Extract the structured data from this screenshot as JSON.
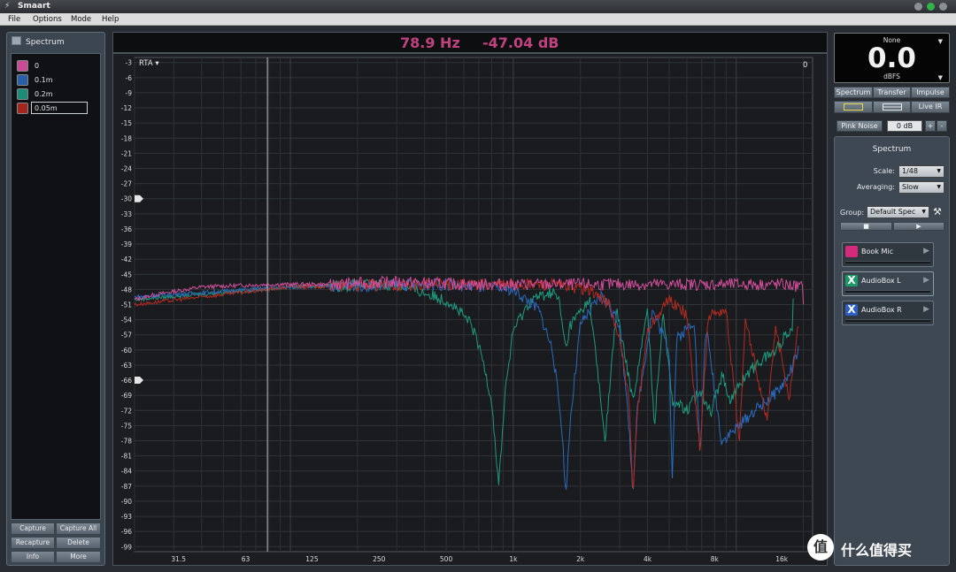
{
  "window": {
    "title": "Smaart"
  },
  "menu": [
    "File",
    "Options",
    "Mode",
    "Help"
  ],
  "left_panel": {
    "header": "Spectrum",
    "traces": [
      {
        "label": "0",
        "color": "#c94b94"
      },
      {
        "label": "0.1m",
        "color": "#2a5fa8"
      },
      {
        "label": "0.2m",
        "color": "#1e8b76"
      },
      {
        "label": "0.05m",
        "color": "#a3261e",
        "editing": true
      }
    ],
    "buttons": [
      "Capture",
      "Capture All",
      "Recapture",
      "Delete",
      "Info",
      "More"
    ]
  },
  "readout": {
    "frequency": "78.9 Hz",
    "level": "-47.04 dB"
  },
  "plot": {
    "mode_label": "RTA ▾",
    "offset_label": "0",
    "y_ticks": [
      "-3",
      "-6",
      "-9",
      "-12",
      "-15",
      "-18",
      "-21",
      "-24",
      "-27",
      "-30",
      "-33",
      "-36",
      "-39",
      "-42",
      "-45",
      "-48",
      "-51",
      "-54",
      "-57",
      "-60",
      "-63",
      "-66",
      "-69",
      "-72",
      "-75",
      "-78",
      "-81",
      "-84",
      "-87",
      "-90",
      "-93",
      "-96",
      "-99"
    ],
    "x_ticks": [
      "31.5",
      "63",
      "125",
      "250",
      "500",
      "1k",
      "2k",
      "4k",
      "8k",
      "16k"
    ]
  },
  "chart_data": {
    "type": "line",
    "title": "",
    "xlabel": "",
    "ylabel": "",
    "x_scale": "log",
    "xlim": [
      20,
      22000
    ],
    "ylim": [
      -100,
      -2
    ],
    "cursor_hz": 78.9,
    "grid": true,
    "series": [
      {
        "name": "0",
        "color": "#d14f9b",
        "points": [
          [
            20,
            -50
          ],
          [
            25,
            -49
          ],
          [
            40,
            -47.5
          ],
          [
            80,
            -47
          ],
          [
            150,
            -47
          ],
          [
            300,
            -46.5
          ],
          [
            600,
            -47
          ],
          [
            1000,
            -47
          ],
          [
            2000,
            -47
          ],
          [
            4000,
            -47
          ],
          [
            8000,
            -47
          ],
          [
            16000,
            -47
          ],
          [
            20000,
            -47.5
          ]
        ]
      },
      {
        "name": "0.1m",
        "color": "#2a6bbf",
        "points": [
          [
            20,
            -49.5
          ],
          [
            100,
            -47.5
          ],
          [
            500,
            -47
          ],
          [
            1000,
            -48
          ],
          [
            1300,
            -52
          ],
          [
            1500,
            -60
          ],
          [
            1650,
            -75
          ],
          [
            1720,
            -89
          ],
          [
            1800,
            -74
          ],
          [
            2000,
            -55
          ],
          [
            2500,
            -49
          ],
          [
            3000,
            -55
          ],
          [
            3300,
            -75
          ],
          [
            3440,
            -88
          ],
          [
            3600,
            -72
          ],
          [
            4200,
            -52
          ],
          [
            5000,
            -60
          ],
          [
            5160,
            -85
          ],
          [
            5400,
            -58
          ],
          [
            6500,
            -54
          ],
          [
            6880,
            -82
          ],
          [
            7300,
            -55
          ],
          [
            8600,
            -78
          ],
          [
            10320,
            -75
          ],
          [
            12040,
            -72
          ],
          [
            13760,
            -70
          ],
          [
            15480,
            -68
          ],
          [
            17200,
            -65
          ],
          [
            19000,
            -60
          ]
        ]
      },
      {
        "name": "0.2m",
        "color": "#1f9a7f",
        "points": [
          [
            20,
            -50
          ],
          [
            100,
            -47.5
          ],
          [
            300,
            -47
          ],
          [
            420,
            -49
          ],
          [
            520,
            -50.5
          ],
          [
            650,
            -55
          ],
          [
            730,
            -62
          ],
          [
            800,
            -70
          ],
          [
            860,
            -87
          ],
          [
            920,
            -68
          ],
          [
            1000,
            -56
          ],
          [
            1200,
            -50
          ],
          [
            1500,
            -48.5
          ],
          [
            1600,
            -50
          ],
          [
            1720,
            -60
          ],
          [
            1800,
            -55
          ],
          [
            2200,
            -50
          ],
          [
            2580,
            -78
          ],
          [
            2900,
            -52
          ],
          [
            3440,
            -70
          ],
          [
            4000,
            -52
          ],
          [
            4300,
            -75
          ],
          [
            4700,
            -52
          ],
          [
            5160,
            -70
          ],
          [
            6020,
            -72
          ],
          [
            6880,
            -68
          ],
          [
            7740,
            -72
          ],
          [
            8600,
            -65
          ],
          [
            9460,
            -70
          ],
          [
            11000,
            -65
          ],
          [
            13000,
            -62
          ],
          [
            15000,
            -60
          ],
          [
            18000,
            -55
          ]
        ]
      },
      {
        "name": "0.05m",
        "color": "#b52a20",
        "points": [
          [
            20,
            -51
          ],
          [
            100,
            -47.5
          ],
          [
            500,
            -47
          ],
          [
            1500,
            -47
          ],
          [
            2200,
            -48
          ],
          [
            2700,
            -51
          ],
          [
            3000,
            -58
          ],
          [
            3300,
            -70
          ],
          [
            3440,
            -89
          ],
          [
            3600,
            -72
          ],
          [
            4000,
            -56
          ],
          [
            5000,
            -50
          ],
          [
            6000,
            -53
          ],
          [
            6880,
            -80
          ],
          [
            7500,
            -53
          ],
          [
            9000,
            -52
          ],
          [
            10320,
            -78
          ],
          [
            11000,
            -54
          ],
          [
            13760,
            -74
          ],
          [
            15000,
            -55
          ],
          [
            17200,
            -70
          ],
          [
            19000,
            -55
          ]
        ]
      }
    ]
  },
  "meter": {
    "source": "None",
    "value": "0.0",
    "unit": "dBFS"
  },
  "right_tabs": [
    "Spectrum",
    "Transfer",
    "Impulse"
  ],
  "view_buttons": {
    "live_ir": "Live IR"
  },
  "generator": {
    "label": "Pink Noise",
    "level": "0 dB",
    "plus": "+",
    "minus": "-"
  },
  "spectrum_panel": {
    "title": "Spectrum",
    "scale_label": "Scale:",
    "scale_value": "1/48",
    "averaging_label": "Averaging:",
    "averaging_value": "Slow",
    "group_label": "Group:",
    "group_value": "Default Spec",
    "measurements": [
      {
        "name": "Book Mic",
        "icon": "",
        "icon_color": "#d42a7e"
      },
      {
        "name": "AudioBox L",
        "icon": "X",
        "icon_color": "#1b9a66"
      },
      {
        "name": "AudioBox R",
        "icon": "X",
        "icon_color": "#2f5fc9"
      }
    ]
  },
  "watermark": {
    "circle": "值",
    "text": "什么值得买"
  }
}
